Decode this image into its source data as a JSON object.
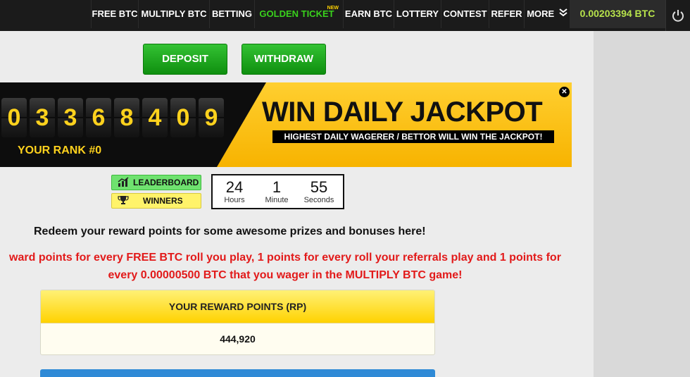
{
  "nav": {
    "items": [
      {
        "label": "FREE BTC"
      },
      {
        "label": "MULTIPLY BTC"
      },
      {
        "label": "BETTING"
      },
      {
        "label": "GOLDEN TICKET",
        "badge": "NEW"
      },
      {
        "label": "EARN BTC"
      },
      {
        "label": "LOTTERY"
      },
      {
        "label": "CONTEST"
      },
      {
        "label": "REFER"
      },
      {
        "label": "MORE"
      }
    ],
    "balance": "0.00203394 BTC",
    "power_icon": "power-icon"
  },
  "actions": {
    "deposit": "DEPOSIT",
    "withdraw": "WITHDRAW"
  },
  "jackpot": {
    "digits": [
      "0",
      "3",
      "3",
      "6",
      "8",
      "4",
      "0",
      "9"
    ],
    "rank": "YOUR RANK #0",
    "title": "WIN DAILY JACKPOT",
    "subtitle": "HIGHEST DAILY WAGERER / BETTOR WILL WIN THE JACKPOT!",
    "close_icon": "close-icon"
  },
  "leaderboard": {
    "leaderboard_label": "LEADERBOARD",
    "winners_label": "WINNERS"
  },
  "timer": {
    "hours_value": "24",
    "hours_label": "Hours",
    "minutes_value": "1",
    "minutes_label": "Minute",
    "seconds_value": "55",
    "seconds_label": "Seconds"
  },
  "rewards": {
    "redeem_text": "Redeem your reward points for some awesome prizes and bonuses here!",
    "info_line1": "ward points for every FREE BTC roll you play, 1 points for every roll your referrals play and 1 points for",
    "info_line2": "every 0.00000500 BTC that you wager in the MULTIPLY BTC game!",
    "box_title": "YOUR REWARD POINTS (RP)",
    "box_value": "444,920"
  },
  "colors": {
    "nav_bg": "#1b1b1b",
    "golden": "#39d11c",
    "balance": "#b7e34b",
    "green_button": "#1ea81e",
    "jackpot_yellow": "#ffc107",
    "info_red": "#e21a1a"
  }
}
